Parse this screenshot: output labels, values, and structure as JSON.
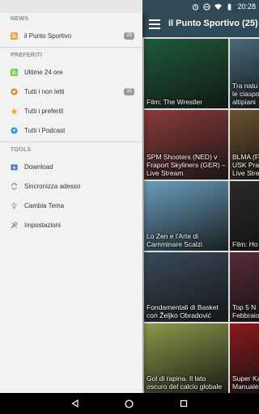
{
  "status": {
    "time": "20:28"
  },
  "app": {
    "title": "il Punto Sportivo (25)"
  },
  "drawer": {
    "sections": [
      {
        "title": "NEWS",
        "items": [
          {
            "label": "il Punto Sportivo",
            "badge": "25",
            "icon": "rss-icon"
          }
        ]
      },
      {
        "title": "PREFERITI",
        "items": [
          {
            "label": "Ultime 24 ore",
            "icon": "rss-icon-green"
          },
          {
            "label": "Tutti i non letti",
            "badge": "25",
            "icon": "unread-icon"
          },
          {
            "label": "Tutti i preferiti",
            "icon": "star-icon"
          },
          {
            "label": "Tutti i Podcast",
            "icon": "podcast-icon"
          }
        ]
      },
      {
        "title": "TOOLS",
        "items": [
          {
            "label": "Download",
            "icon": "download-icon"
          },
          {
            "label": "Sincronizza adesso",
            "icon": "sync-icon"
          },
          {
            "label": "Cambia Tema",
            "icon": "bulb-icon"
          },
          {
            "label": "Impostazioni",
            "icon": "settings-icon"
          }
        ]
      }
    ]
  },
  "tiles": [
    {
      "caption": "Film: The Wrestler",
      "color": "#1e5a3a"
    },
    {
      "caption": "Tra natu le ciaspo altipiani",
      "color": "#4a6a7a"
    },
    {
      "caption": "SPM Shooters (NED) v Fraport Skyliners (GER) – Live Stream",
      "color": "#8a3b3b"
    },
    {
      "caption": "BLMA (F USK Pra Live Stre",
      "color": "#6b5230"
    },
    {
      "caption": "Lo Zen e l'Arte di Camminare Scalzi",
      "color": "#6a9fbf"
    },
    {
      "caption": "Film: Ho",
      "color": "#2a2a2a"
    },
    {
      "caption": "Fondamentali di Basket con Željko Obradović",
      "color": "#3a4a5a"
    },
    {
      "caption": "Top 5 N Febbraio",
      "color": "#5a2a3a"
    },
    {
      "caption": "Gol di rapina. Il lato oscuro del calcio globale",
      "color": "#8a9a4a"
    },
    {
      "caption": "Super Ka Manuale",
      "color": "#8a1a1a"
    }
  ]
}
